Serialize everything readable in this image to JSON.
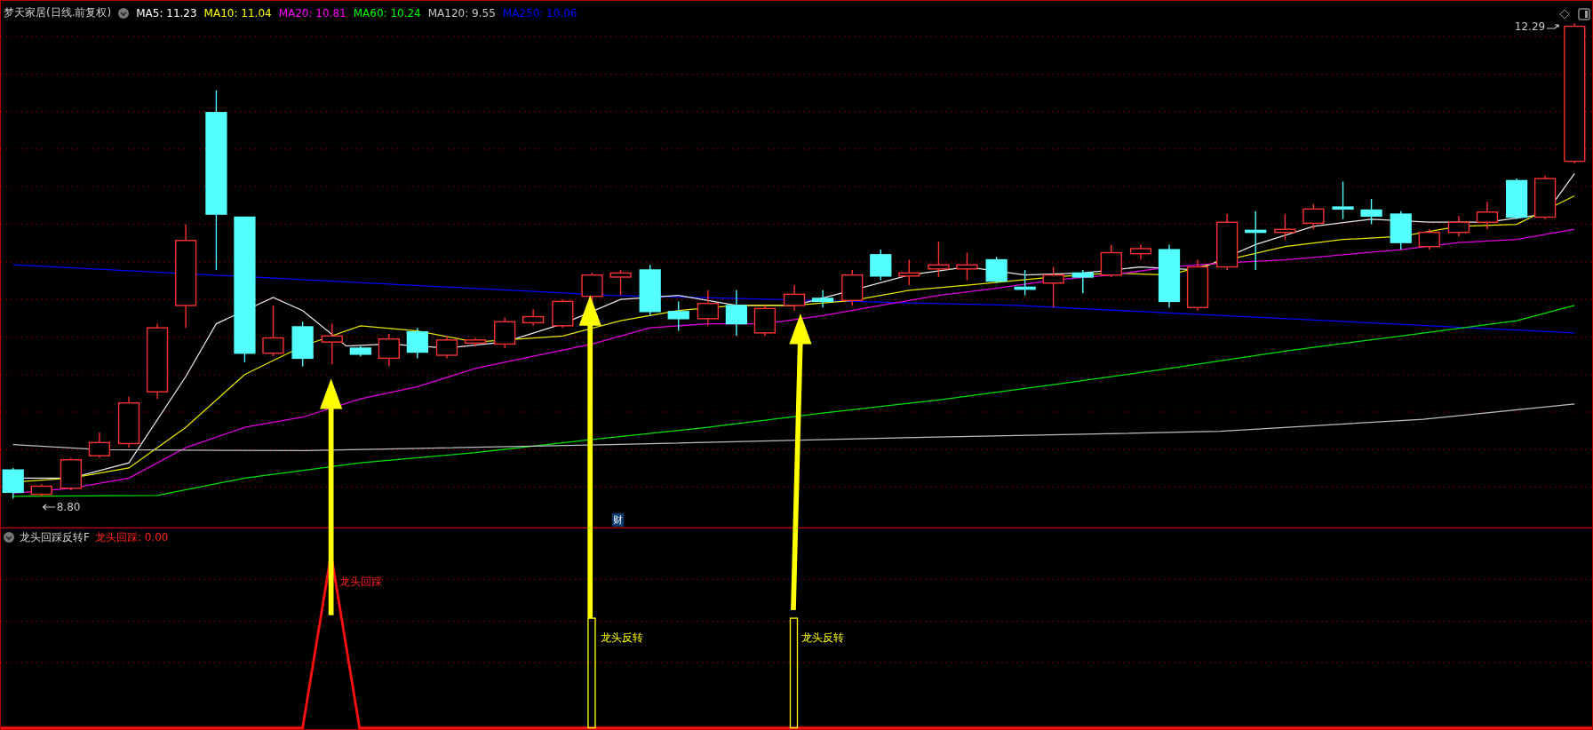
{
  "stock_header": {
    "title": "梦天家居(日线.前复权)",
    "ma_values": [
      {
        "label": "MA5: 11.23",
        "color": "#ffffff"
      },
      {
        "label": "MA10: 11.04",
        "color": "#ffff00"
      },
      {
        "label": "MA20: 10.81",
        "color": "#ff00ff"
      },
      {
        "label": "MA60: 10.24",
        "color": "#00ff00"
      },
      {
        "label": "MA120: 9.55",
        "color": "#c8c8c8"
      },
      {
        "label": "MA250: 10.06",
        "color": "#0000ff"
      }
    ]
  },
  "price_markers": [
    {
      "kind": "high",
      "value": "12.29"
    },
    {
      "kind": "low",
      "value": "8.80"
    }
  ],
  "finance_tag": "财",
  "indicator": {
    "title": "龙头回踩反转F",
    "reading": "龙头回踩: 0.00",
    "signals": [
      {
        "kind": "pullback",
        "label": "龙头回踩"
      },
      {
        "kind": "reversal",
        "label": "龙头反转"
      },
      {
        "kind": "reversal",
        "label": "龙头反转"
      }
    ]
  }
}
